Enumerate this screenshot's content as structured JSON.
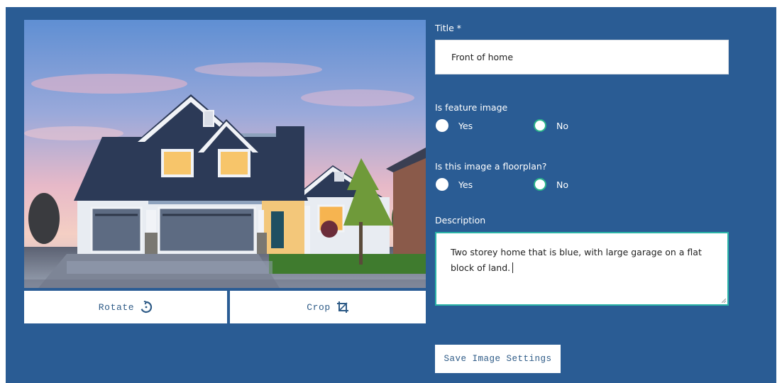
{
  "image_editor": {
    "rotate_label": "Rotate",
    "crop_label": "Crop",
    "rotate_icon": "rotate-icon",
    "crop_icon": "crop-icon",
    "photo": "house-photo"
  },
  "form": {
    "title_label": "Title *",
    "title_value": "Front of home",
    "feature_label": "Is feature image",
    "feature_options": {
      "yes": "Yes",
      "no": "No",
      "selected": "No"
    },
    "floorplan_label": "Is this image a floorplan?",
    "floorplan_options": {
      "yes": "Yes",
      "no": "No",
      "selected": "No"
    },
    "description_label": "Description",
    "description_value": "Two storey home that is blue, with large garage on a flat block of land.",
    "save_label": "Save Image Settings"
  },
  "colors": {
    "panel_bg": "#2a5c94",
    "accent_teal": "#2bb48a",
    "button_text": "#2d5a86"
  }
}
